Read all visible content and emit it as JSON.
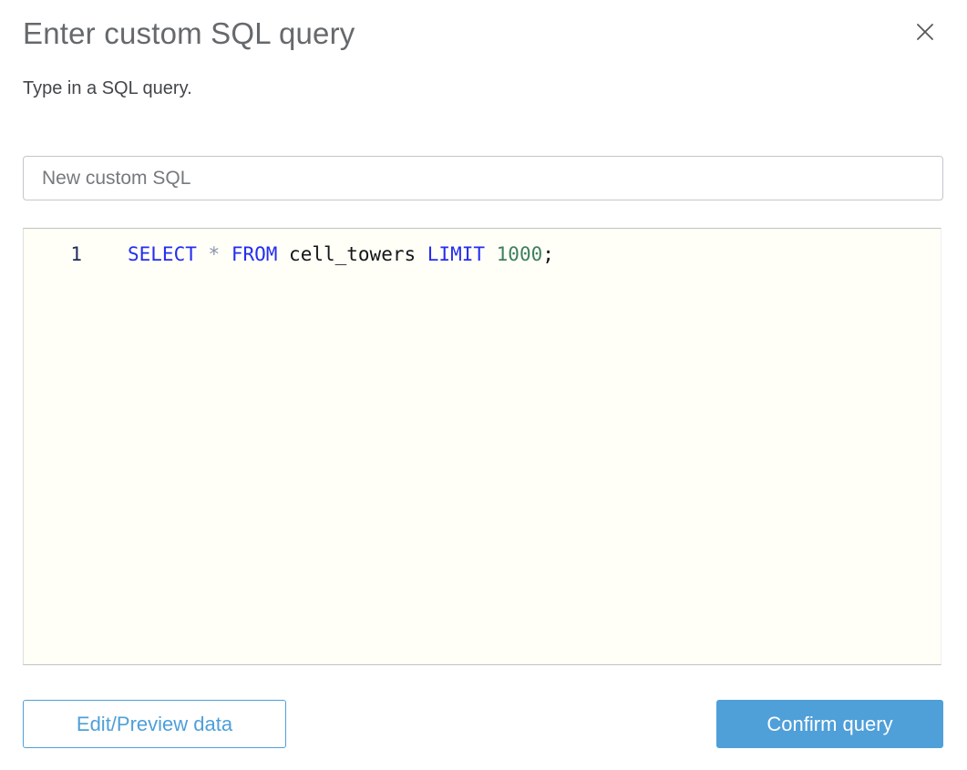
{
  "dialog": {
    "title": "Enter custom SQL query",
    "subtitle": "Type in a SQL query."
  },
  "name_input": {
    "value": "New custom SQL"
  },
  "editor": {
    "line_number": "1",
    "query_text": "SELECT * FROM cell_towers LIMIT 1000;",
    "tokens": [
      {
        "text": "SELECT",
        "type": "keyword"
      },
      {
        "text": " ",
        "type": "plain"
      },
      {
        "text": "*",
        "type": "operator"
      },
      {
        "text": " ",
        "type": "plain"
      },
      {
        "text": "FROM",
        "type": "keyword"
      },
      {
        "text": " cell_towers ",
        "type": "plain"
      },
      {
        "text": "LIMIT",
        "type": "keyword"
      },
      {
        "text": " ",
        "type": "plain"
      },
      {
        "text": "1000",
        "type": "number"
      },
      {
        "text": ";",
        "type": "plain"
      }
    ]
  },
  "footer": {
    "edit_preview_label": "Edit/Preview data",
    "confirm_label": "Confirm query"
  },
  "colors": {
    "keyword": "#232df2",
    "operator": "#8a94ae",
    "number": "#3d7e5f",
    "plain": "#141519",
    "gutter_text": "#1f2a5e",
    "accent_blue": "#4f9fd9",
    "title_gray": "#66696c",
    "close_gray": "#56585c"
  }
}
